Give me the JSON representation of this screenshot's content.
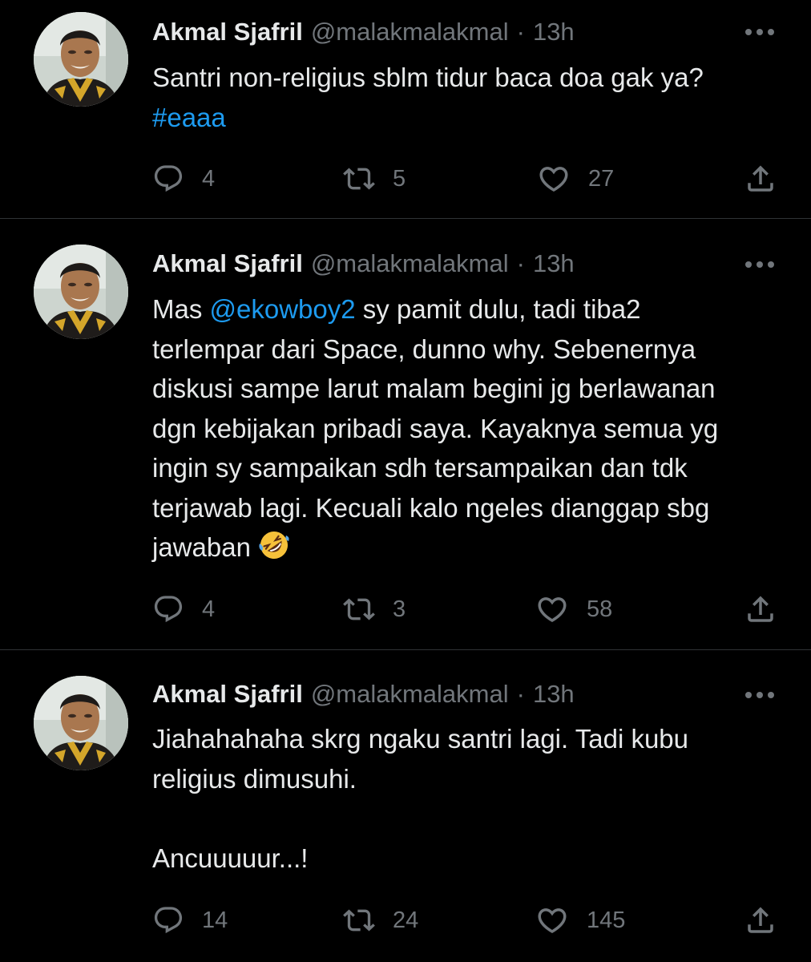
{
  "colors": {
    "background": "#000000",
    "text": "#e7e9ea",
    "muted": "#71767b",
    "link": "#1d9bf0",
    "divider": "#2f3336"
  },
  "icons": {
    "reply": "reply-icon",
    "retweet": "retweet-icon",
    "like": "heart-icon",
    "share": "share-icon",
    "more": "more-icon",
    "emoji": "rolling-on-floor-laughing-emoji"
  },
  "tweets": [
    {
      "name": "Akmal Sjafril",
      "handle": "@malakmalakmal",
      "dot": "·",
      "time": "13h",
      "text_line1": "Santri non-religius sblm tidur baca doa gak ya?",
      "hashtag": "#eaaa",
      "replies": "4",
      "retweets": "5",
      "likes": "27"
    },
    {
      "name": "Akmal Sjafril",
      "handle": "@malakmalakmal",
      "dot": "·",
      "time": "13h",
      "text_prefix": "Mas ",
      "mention": "@ekowboy2",
      "text_line1_rest": " sy pamit dulu, tadi tiba2",
      "text_line2": "terlempar dari Space, dunno why. Sebenernya",
      "text_line3": "diskusi sampe larut malam begini jg berlawanan",
      "text_line4": "dgn kebijakan pribadi saya. Kayaknya semua yg",
      "text_line5": "ingin sy sampaikan sdh tersampaikan dan tdk",
      "text_line6": "terjawab lagi. Kecuali kalo ngeles dianggap sbg",
      "text_line7": "jawaban",
      "replies": "4",
      "retweets": "3",
      "likes": "58"
    },
    {
      "name": "Akmal Sjafril",
      "handle": "@malakmalakmal",
      "dot": "·",
      "time": "13h",
      "text_line1": "Jiahahahaha skrg ngaku santri lagi. Tadi kubu",
      "text_line2": "religius dimusuhi.",
      "text_line3": "Ancuuuuur...!",
      "replies": "14",
      "retweets": "24",
      "likes": "145"
    }
  ]
}
